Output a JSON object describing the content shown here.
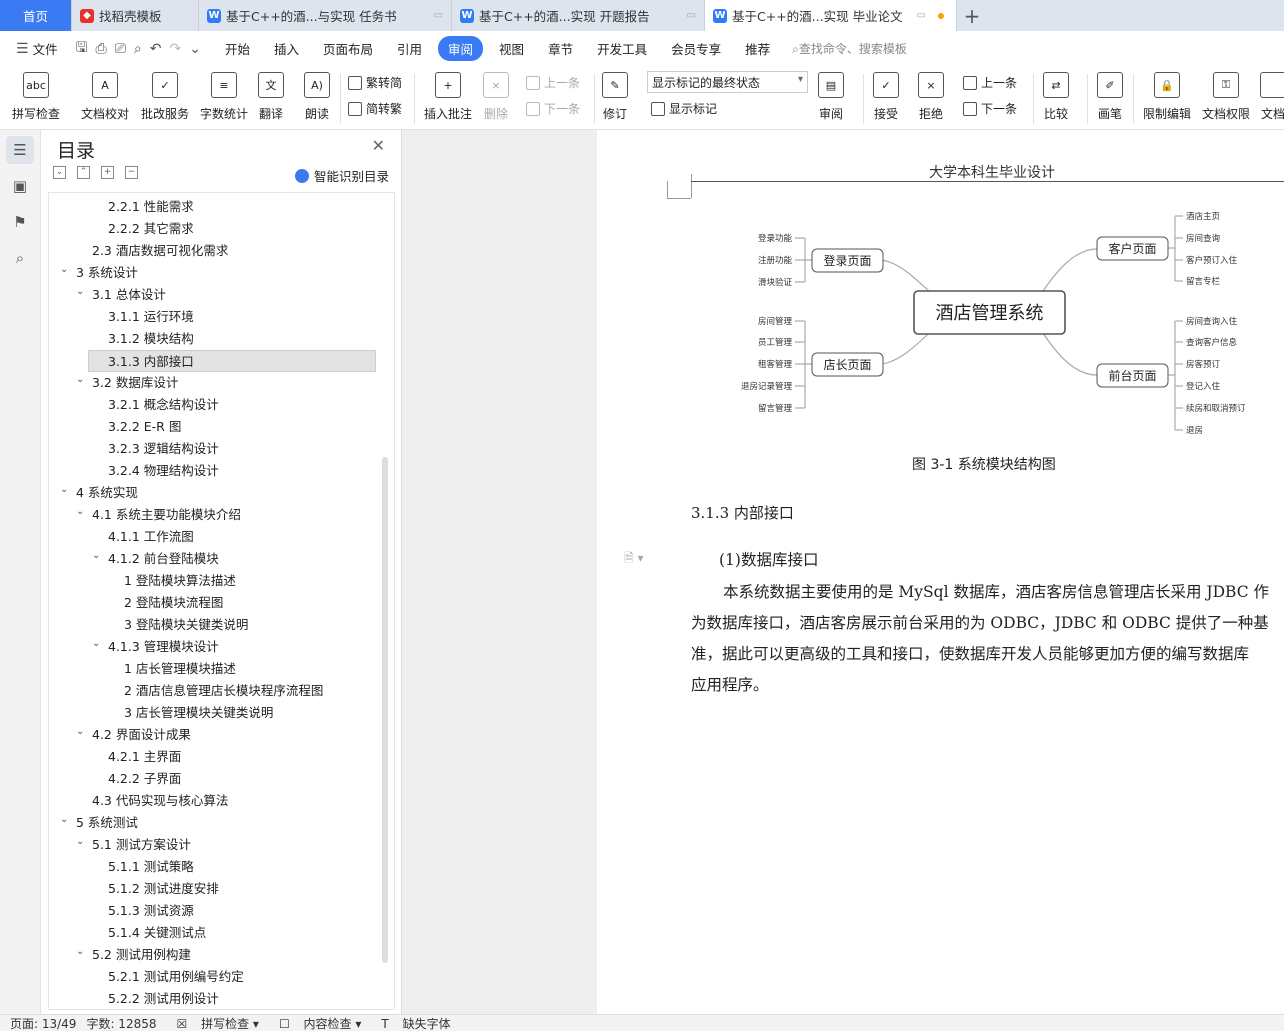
{
  "tabs": [
    {
      "label": "首页",
      "icon": "home"
    },
    {
      "label": "找稻壳模板",
      "icon": "docer-icon"
    },
    {
      "label": "基于C++的酒...与实现 任务书",
      "icon": "w-doc-icon"
    },
    {
      "label": "基于C++的酒...实现 开题报告",
      "icon": "w-doc-icon"
    },
    {
      "label": "基于C++的酒...实现 毕业论文",
      "icon": "w-doc-icon"
    }
  ],
  "menu": {
    "file": "文件",
    "items": [
      "开始",
      "插入",
      "页面布局",
      "引用",
      "审阅",
      "视图",
      "章节",
      "开发工具",
      "会员专享",
      "推荐"
    ],
    "active": "审阅",
    "search": "查找命令、搜索模板"
  },
  "ribbon": {
    "spell": "拼写检查",
    "proof": "文档校对",
    "batch": "批改服务",
    "count": "字数统计",
    "translate": "翻译",
    "read": "朗读",
    "trad": "繁转简",
    "simp": "简转繁",
    "insert_comment": "插入批注",
    "delete": "删除",
    "prev": "上一条",
    "next": "下一条",
    "revise": "修订",
    "show_mode": "显示标记的最终状态",
    "show_marks": "显示标记",
    "review": "审阅",
    "accept": "接受",
    "reject": "拒绝",
    "prev2": "上一条",
    "next2": "下一条",
    "compare": "比较",
    "pen": "画笔",
    "limit": "限制编辑",
    "rights": "文档权限",
    "doc": "文档"
  },
  "toc": {
    "title": "目录",
    "smart": "智能识别目录",
    "items": [
      "2.2.1  性能需求",
      "2.2.2  其它需求",
      "2.3  酒店数据可视化需求",
      "3  系统设计",
      "3.1  总体设计",
      "3.1.1 运行环境",
      "3.1.2 模块结构",
      "3.1.3 内部接口",
      "3.2  数据库设计",
      "3.2.1  概念结构设计",
      "3.2.2 E-R 图",
      "3.2.3  逻辑结构设计",
      "3.2.4  物理结构设计",
      "4  系统实现",
      "4.1  系统主要功能模块介绍",
      "4.1.1  工作流图",
      "4.1.2  前台登陆模块",
      "1 登陆模块算法描述",
      "2  登陆模块流程图",
      "3 登陆模块关键类说明",
      "4.1.3 管理模块设计",
      "1 店长管理模块描述",
      "2 酒店信息管理店长模块程序流程图",
      "3 店长管理模块关键类说明",
      "4.2  界面设计成果",
      "4.2.1  主界面",
      "4.2.2  子界面",
      "4.3  代码实现与核心算法",
      "5  系统测试",
      "5.1  测试方案设计",
      "5.1.1  测试策略",
      "5.1.2  测试进度安排",
      "5.1.3  测试资源",
      "5.1.4  关键测试点",
      "5.2  测试用例构建",
      "5.2.1  测试用例编号约定",
      "5.2.2  测试用例设计"
    ],
    "selected_index": 7
  },
  "document": {
    "header": "大学本科生毕业设计",
    "mindmap": {
      "center": "酒店管理系统",
      "login": {
        "label": "登录页面",
        "leaves": [
          "登录功能",
          "注册功能",
          "滑块验证"
        ]
      },
      "manager": {
        "label": "店长页面",
        "leaves": [
          "房间管理",
          "员工管理",
          "租客管理",
          "退房记录管理",
          "留言管理"
        ]
      },
      "customer": {
        "label": "客户页面",
        "leaves": [
          "酒店主页",
          "房间查询",
          "客户预订入住",
          "留言专栏"
        ]
      },
      "front": {
        "label": "前台页面",
        "leaves": [
          "房间查询入住",
          "查询客户信息",
          "房客预订",
          "登记入住",
          "续房和取消预订",
          "退房"
        ]
      }
    },
    "caption": "图  3-1  系统模块结构图",
    "heading": "3.1.3 内部接口",
    "paragraphs": [
      "(1)数据库接口",
      "本系统数据主要使用的是 MySql 数据库，酒店客房信息管理店长采用 JDBC 作",
      "为数据库接口，酒店客房展示前台采用的为 ODBC，JDBC 和 ODBC 提供了一种基",
      "准，据此可以更高级的工具和接口，使数据库开发人员能够更加方便的编写数据库",
      "应用程序。"
    ]
  },
  "status": {
    "page": "页面: 13/49",
    "words": "字数: 12858",
    "spell": "拼写检查",
    "content": "内容检查",
    "missing_font": "缺失字体"
  }
}
